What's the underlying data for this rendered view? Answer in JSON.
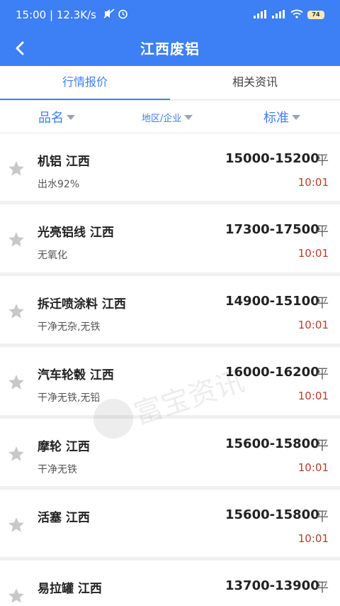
{
  "status_bar": {
    "time_speed": "15:00 | 12.3K/s",
    "battery": "74"
  },
  "header": {
    "title": "江西废铝"
  },
  "tabs": [
    {
      "label": "行情报价",
      "active": true
    },
    {
      "label": "相关资讯",
      "active": false
    }
  ],
  "filters": {
    "name": "品名",
    "region": "地区/企业",
    "standard": "标准"
  },
  "items": [
    {
      "name": "机铝  江西",
      "sub": "出水92%",
      "price": "15000-15200",
      "unit": "平",
      "time": "10:01"
    },
    {
      "name": "光亮铝线  江西",
      "sub": "无氧化",
      "price": "17300-17500",
      "unit": "平",
      "time": "10:01"
    },
    {
      "name": "拆迁喷涂料  江西",
      "sub": "干净无杂,无铁",
      "price": "14900-15100",
      "unit": "平",
      "time": "10:01"
    },
    {
      "name": "汽车轮毂  江西",
      "sub": "干净无铁,无铅",
      "price": "16000-16200",
      "unit": "平",
      "time": "10:01"
    },
    {
      "name": "摩轮  江西",
      "sub": "干净无铁",
      "price": "15600-15800",
      "unit": "平",
      "time": "10:01"
    },
    {
      "name": "活塞  江西",
      "sub": "",
      "price": "15600-15800",
      "unit": "平",
      "time": "10:01"
    },
    {
      "name": "易拉罐  江西",
      "sub": "",
      "price": "13700-13900",
      "unit": "平",
      "time": ""
    }
  ],
  "watermark": "富宝资讯",
  "colors": {
    "primary": "#3d7ff5",
    "time": "#c0392b"
  }
}
